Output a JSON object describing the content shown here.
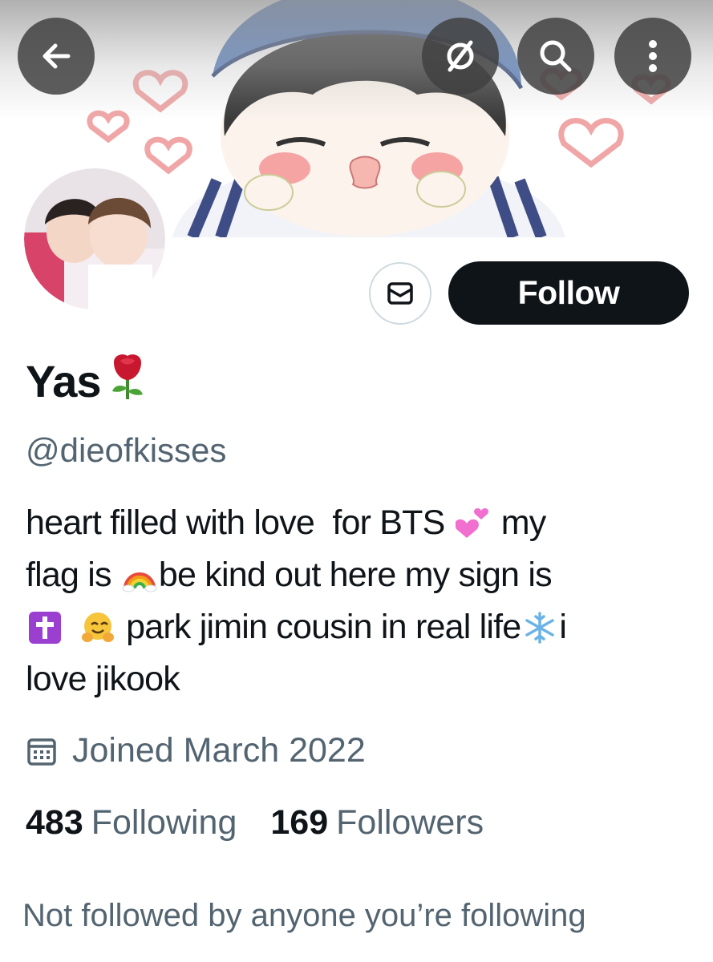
{
  "header": {
    "back_icon": "arrow-left-icon",
    "mute_icon": "eye-slash-icon",
    "search_icon": "search-icon",
    "more_icon": "more-vertical-icon"
  },
  "profile": {
    "display_name": "Yas",
    "name_emoji": "rose",
    "handle": "@dieofkisses",
    "bio_lines": [
      {
        "before": "heart filled with love  for BTS ",
        "emoji": "two-hearts",
        "after": " my"
      },
      {
        "before": "flag is ",
        "emoji": "rainbow",
        "after": "be kind out here my sign is"
      },
      {
        "emoji1": "latin-cross",
        "emoji2": "hugging-face",
        "text": " park jimin cousin in real life",
        "emoji3": "snowflake",
        "after": "i"
      },
      {
        "text": "love jikook"
      }
    ],
    "joined": "Joined March 2022"
  },
  "actions": {
    "follow_label": "Follow",
    "message_icon": "envelope-icon"
  },
  "stats": {
    "following_count": "483",
    "following_label": "Following",
    "followers_count": "169",
    "followers_label": "Followers"
  },
  "footer": {
    "not_followed_text": "Not followed by anyone you’re following"
  },
  "colors": {
    "primary_text": "#0f1419",
    "secondary_text": "#536471",
    "follow_bg": "#0f1419",
    "border": "#cfd9de"
  }
}
